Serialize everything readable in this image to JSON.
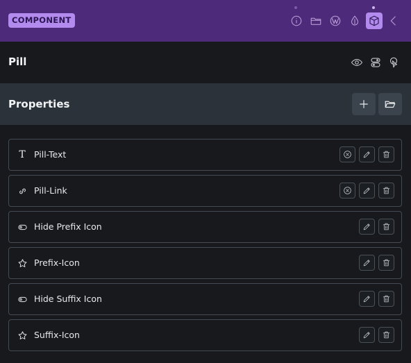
{
  "header": {
    "badge": "COMPONENT",
    "accent": "#4e2a7a",
    "badge_color": "#b38aee",
    "icons": [
      "info-icon",
      "folder-icon",
      "wordpress-icon",
      "drop-icon",
      "box-icon",
      "chevron-left-icon"
    ],
    "active_icon": "box-icon"
  },
  "component": {
    "title": "Pill",
    "icons": [
      "eye-icon",
      "toggle-stack-icon",
      "pointer-icon"
    ]
  },
  "properties": {
    "title": "Properties",
    "buttons": [
      "plus-icon",
      "folder-open-icon"
    ],
    "items": [
      {
        "label": "Pill-Text",
        "icon": "text-icon",
        "actions": [
          "clear-icon",
          "edit-icon",
          "trash-icon"
        ]
      },
      {
        "label": "Pill-Link",
        "icon": "link-icon",
        "actions": [
          "clear-icon",
          "edit-icon",
          "trash-icon"
        ]
      },
      {
        "label": "Hide Prefix Icon",
        "icon": "toggle-icon",
        "actions": [
          "edit-icon",
          "trash-icon"
        ]
      },
      {
        "label": "Prefix-Icon",
        "icon": "star-icon",
        "actions": [
          "edit-icon",
          "trash-icon"
        ]
      },
      {
        "label": "Hide Suffix Icon",
        "icon": "toggle-icon",
        "actions": [
          "edit-icon",
          "trash-icon"
        ]
      },
      {
        "label": "Suffix-Icon",
        "icon": "star-icon",
        "actions": [
          "edit-icon",
          "trash-icon"
        ]
      }
    ]
  }
}
